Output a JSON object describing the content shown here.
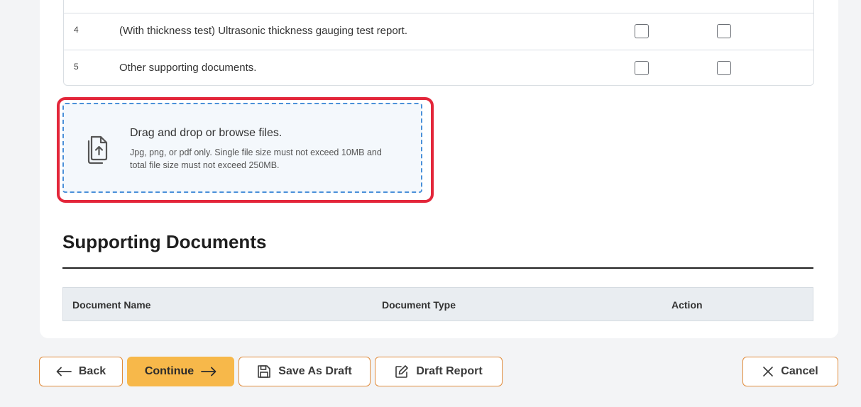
{
  "checklist": {
    "rows": [
      {
        "num": "4",
        "text": "(With thickness test) Ultrasonic thickness gauging test report."
      },
      {
        "num": "5",
        "text": "Other supporting documents."
      }
    ]
  },
  "dropzone": {
    "icon": "file-upload-icon",
    "title": "Drag and drop or browse files.",
    "subtitle": "Jpg, png, or pdf only. Single file size must not exceed 10MB and total file size must not exceed 250MB."
  },
  "supporting_documents": {
    "title": "Supporting Documents",
    "columns": [
      "Document Name",
      "Document Type",
      "Action"
    ]
  },
  "footer": {
    "back_label": "Back",
    "continue_label": "Continue",
    "save_draft_label": "Save As Draft",
    "draft_report_label": "Draft Report",
    "cancel_label": "Cancel"
  },
  "colors": {
    "accent": "#f7b84a",
    "button_border": "#e08c3c",
    "highlight": "#e3263a",
    "dropzone_border": "#4a90d9"
  }
}
